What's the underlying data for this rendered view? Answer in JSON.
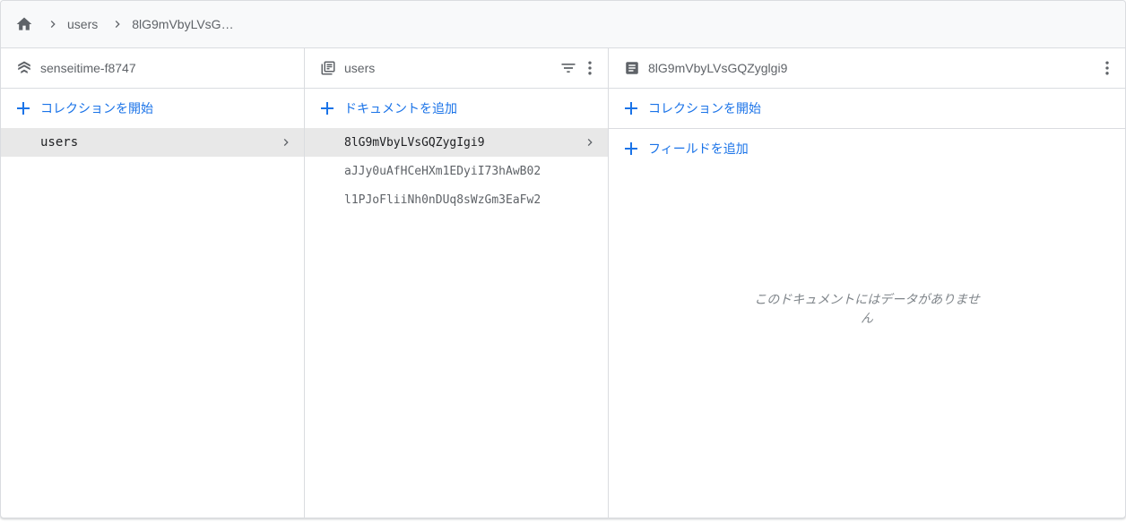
{
  "breadcrumb": {
    "home_icon": "home-icon",
    "items": [
      "users",
      "8lG9mVbyLVsG…"
    ]
  },
  "panel_project": {
    "title": "senseitime-f8747",
    "icon": "firestore-stack-icon",
    "start_collection_label": "コレクションを開始",
    "items": [
      {
        "label": "users",
        "selected": true
      }
    ]
  },
  "panel_collection": {
    "title": "users",
    "icon": "collection-icon",
    "add_document_label": "ドキュメントを追加",
    "items": [
      {
        "label": "8lG9mVbyLVsGQZygIgi9",
        "selected": true
      },
      {
        "label": "aJJy0uAfHCeHXm1EDyiI73hAwB02",
        "selected": false
      },
      {
        "label": "l1PJoFliiNh0nDUq8sWzGm3EaFw2",
        "selected": false
      }
    ]
  },
  "panel_document": {
    "title": "8lG9mVbyLVsGQZyglgi9",
    "icon": "document-icon",
    "start_collection_label": "コレクションを開始",
    "add_field_label": "フィールドを追加",
    "empty_message": "このドキュメントにはデータがありません"
  },
  "colors": {
    "accent": "#1a73e8",
    "selected_row": "#e8e8e8",
    "border": "#dadce0",
    "breadcrumb_bg": "#f8f9fa"
  }
}
